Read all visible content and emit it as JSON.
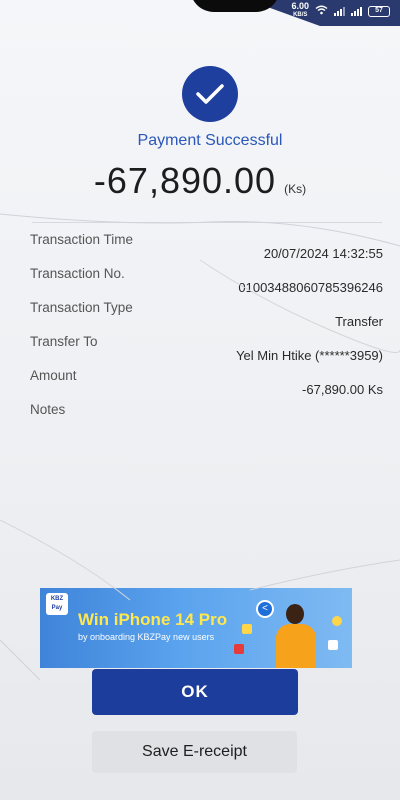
{
  "status_bar": {
    "speed_value": "6.00",
    "speed_unit": "KB/S",
    "battery": "57"
  },
  "header": {
    "title": "Payment Successful",
    "amount": "-67,890.00",
    "currency": "(Ks)"
  },
  "details": [
    {
      "label": "Transaction Time",
      "value": "20/07/2024 14:32:55"
    },
    {
      "label": "Transaction No.",
      "value": "01003488060785396246"
    },
    {
      "label": "Transaction Type",
      "value": "Transfer"
    },
    {
      "label": "Transfer To",
      "value": "Yel Min Htike (******3959)"
    },
    {
      "label": "Amount",
      "value": "-67,890.00 Ks"
    },
    {
      "label": "Notes",
      "value": ""
    }
  ],
  "banner": {
    "logo_text": "KBZ Pay",
    "title": "Win iPhone 14 Pro",
    "subtitle": "by onboarding KBZPay new users"
  },
  "buttons": {
    "ok": "OK",
    "save_receipt": "Save E-receipt"
  }
}
